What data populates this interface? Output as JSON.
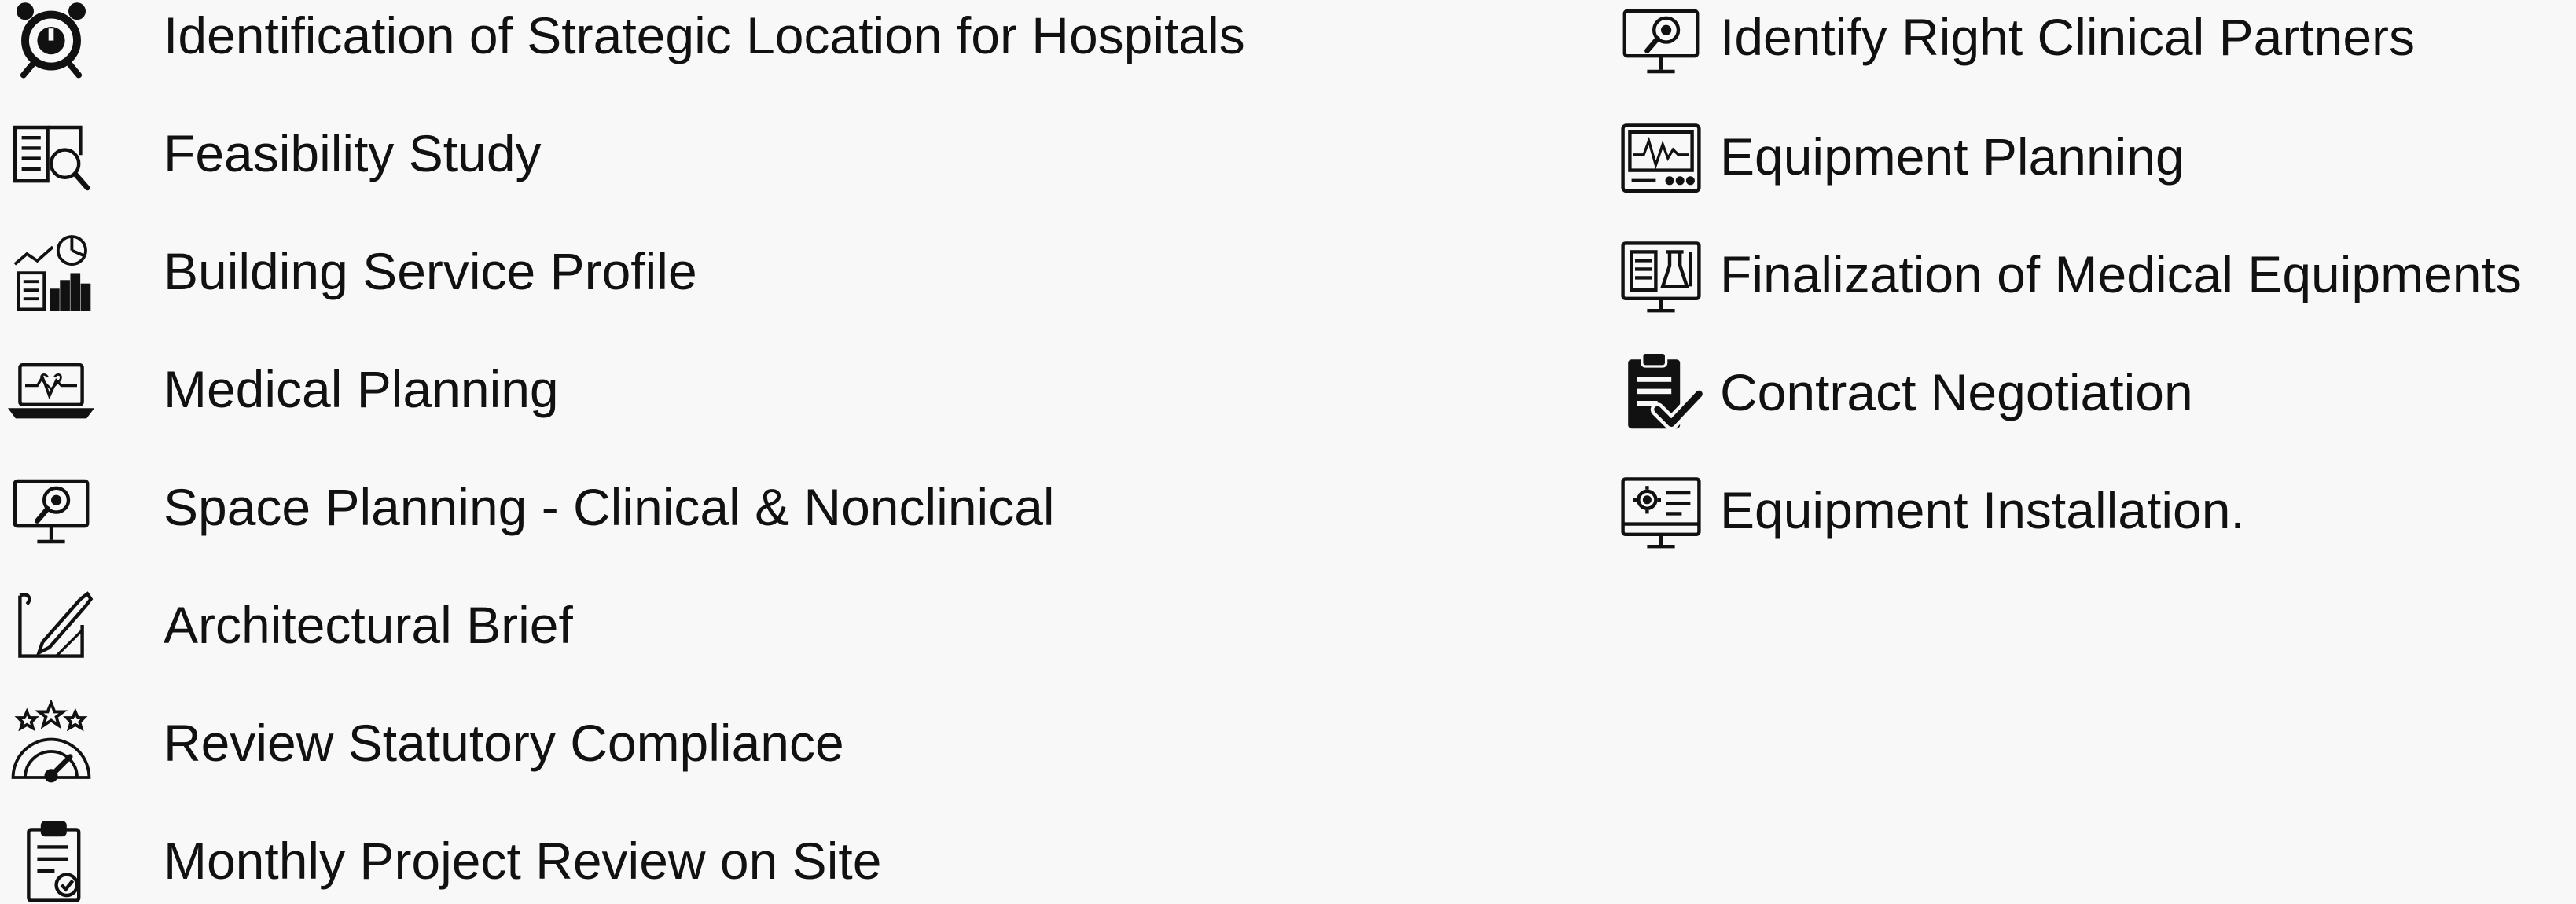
{
  "services": {
    "left_column": [
      {
        "label": "Identification of Strategic Location for Hospitals",
        "icon": "alarm-clock-icon"
      },
      {
        "label": "Feasibility Study",
        "icon": "book-search-icon"
      },
      {
        "label": "Building Service Profile",
        "icon": "building-chart-icon"
      },
      {
        "label": "Medical Planning",
        "icon": "laptop-heartbeat-icon"
      },
      {
        "label": "Space Planning - Clinical & Nonclinical",
        "icon": "monitor-search-icon"
      },
      {
        "label": "Architectural Brief",
        "icon": "blueprint-pencil-icon"
      },
      {
        "label": "Review Statutory Compliance",
        "icon": "rating-gauge-icon"
      },
      {
        "label": "Monthly Project Review on Site",
        "icon": "clipboard-check-icon"
      }
    ],
    "right_column": [
      {
        "label": "Identify Right Clinical Partners",
        "icon": "monitor-search-icon"
      },
      {
        "label": "Equipment Planning",
        "icon": "ecg-monitor-icon"
      },
      {
        "label": "Finalization of Medical Equipments",
        "icon": "monitor-lab-icon"
      },
      {
        "label": "Contract Negotiation",
        "icon": "clipboard-checkmark-icon"
      },
      {
        "label": "Equipment Installation.",
        "icon": "monitor-gear-icon"
      }
    ]
  }
}
